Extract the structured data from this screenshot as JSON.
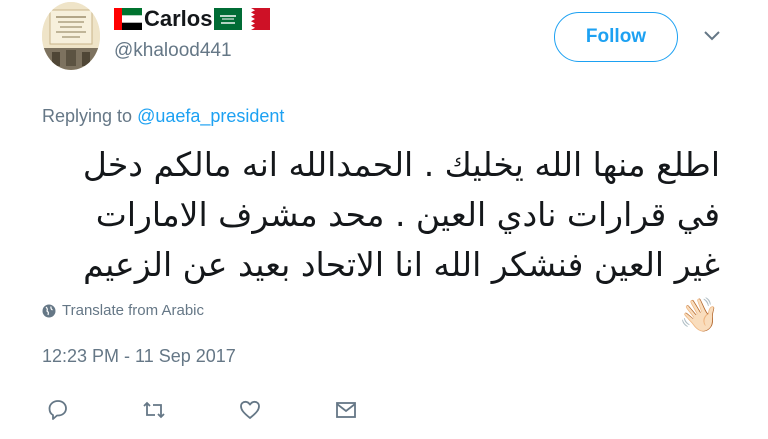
{
  "user": {
    "display_name": "Carlos",
    "handle": "@khalood441",
    "follow_label": "Follow"
  },
  "reply": {
    "prefix": "Replying to ",
    "mention": "@uaefa_president"
  },
  "tweet": {
    "text": "اطلع منها الله يخليك . الحمدالله انه مالكم دخل في قرارات نادي العين  . محد مشرف الامارات غير العين فنشكر الله انا الاتحاد بعيد عن الزعيم",
    "emoji": "👋🏻"
  },
  "translate_label": "Translate from Arabic",
  "timestamp": "12:23 PM - 11 Sep 2017",
  "icons": {
    "reply": "reply-icon",
    "retweet": "retweet-icon",
    "like": "heart-icon",
    "message": "envelope-icon",
    "globe": "globe-icon",
    "more": "chevron-down-icon"
  },
  "colors": {
    "accent": "#1da1f2",
    "secondary_text": "#657786",
    "primary_text": "#14171a"
  }
}
